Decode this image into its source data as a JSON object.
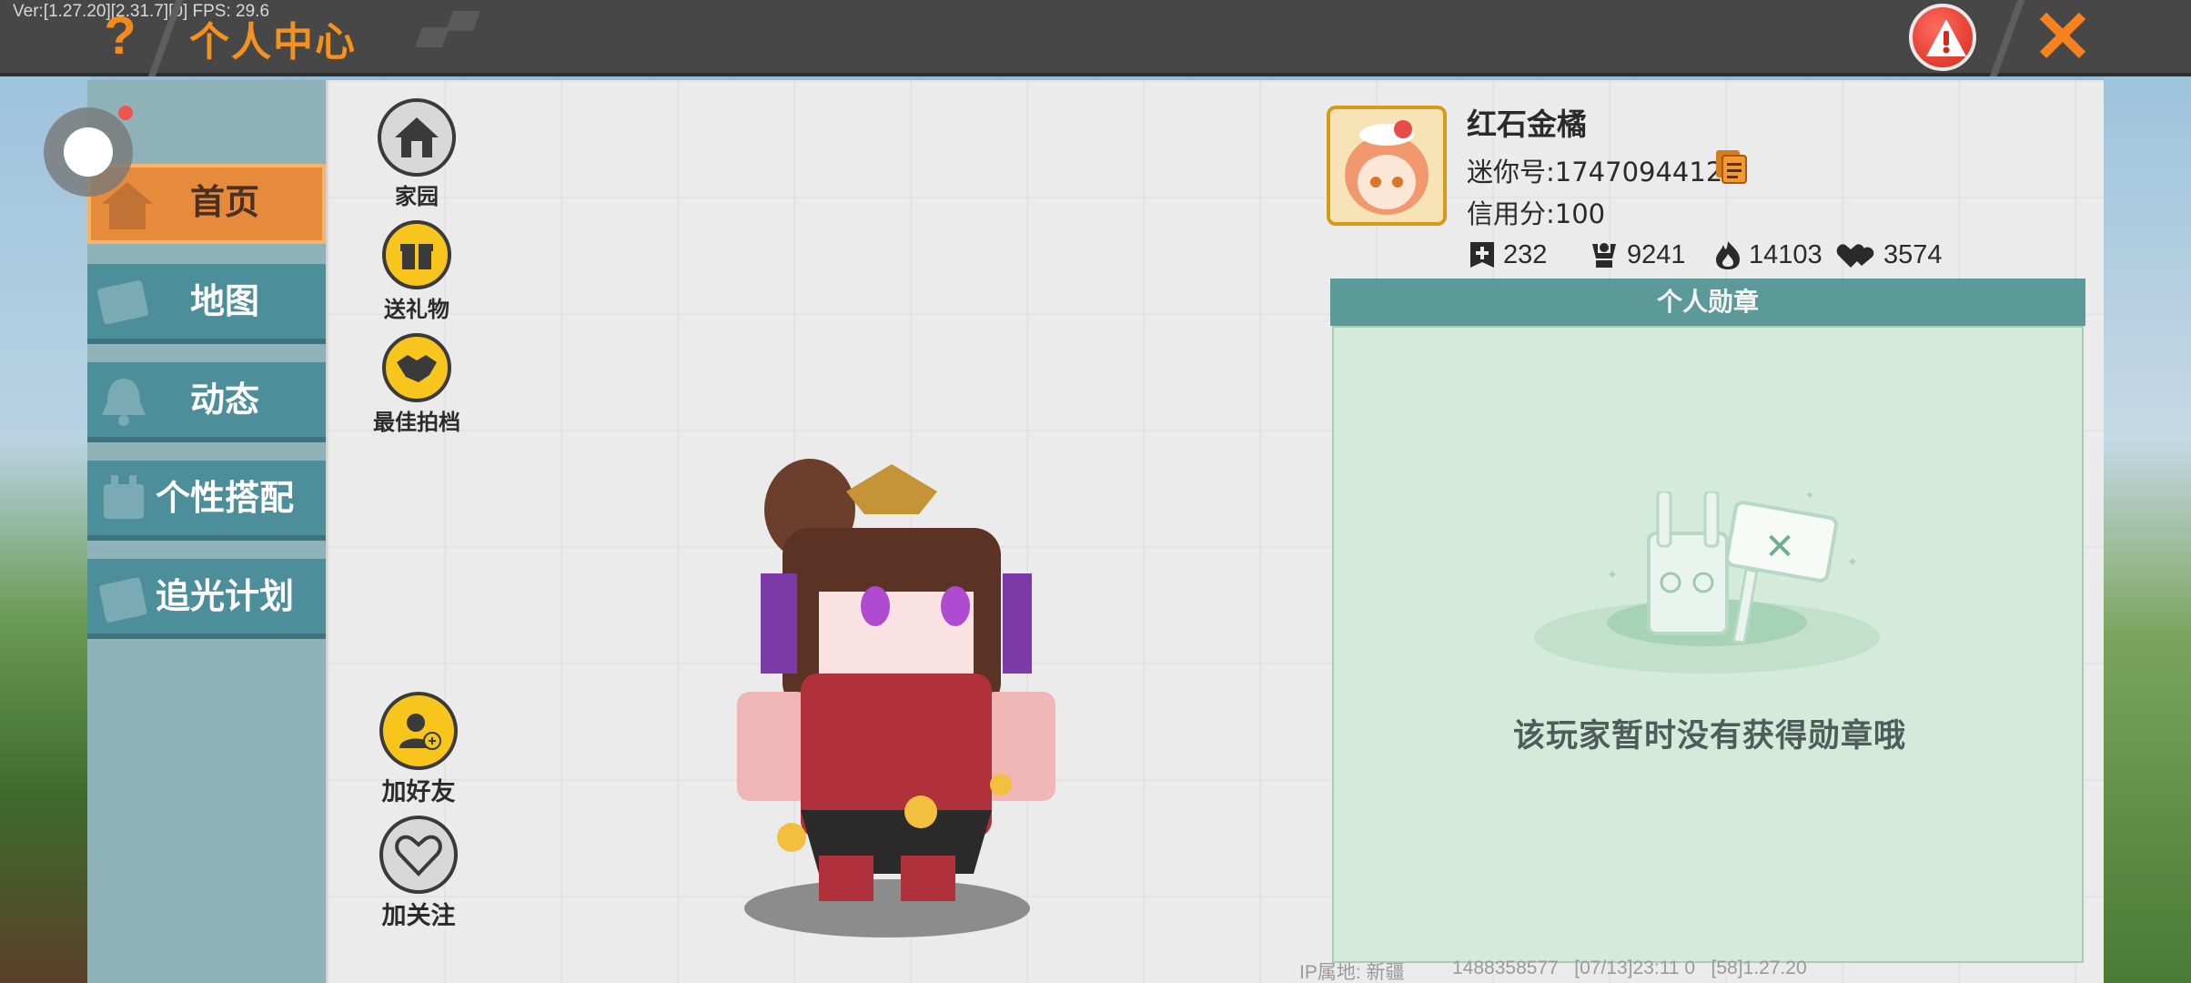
{
  "debug": {
    "version_text": "Ver:[1.27.20][2.31.7][0] FPS: 29.6"
  },
  "header": {
    "title": "个人中心",
    "help_icon": "question-mark-icon",
    "report_icon": "warning-icon",
    "close_icon": "close-icon"
  },
  "sidebar": {
    "items": [
      {
        "label": "首页",
        "icon": "home-icon",
        "active": true
      },
      {
        "label": "地图",
        "icon": "map-icon",
        "active": false
      },
      {
        "label": "动态",
        "icon": "bell-icon",
        "active": false
      },
      {
        "label": "个性搭配",
        "icon": "outfit-icon",
        "active": false
      },
      {
        "label": "追光计划",
        "icon": "calendar-icon",
        "active": false
      }
    ]
  },
  "actions": {
    "homeland": "家园",
    "send_gift": "送礼物",
    "best_partner": "最佳拍档",
    "add_friend": "加好友",
    "follow": "加关注"
  },
  "profile": {
    "nickname": "红石金橘",
    "mini_id": "迷你号:1747094412",
    "credit": "信用分:100",
    "stats": [
      {
        "icon": "add-icon",
        "value": "232"
      },
      {
        "icon": "trophy-icon",
        "value": "9241"
      },
      {
        "icon": "flame-icon",
        "value": "14103"
      },
      {
        "icon": "hearts-icon",
        "value": "3574"
      }
    ]
  },
  "medals": {
    "title": "个人勋章",
    "empty_text": "该玩家暂时没有获得勋章哦"
  },
  "footer": {
    "ip_location": "IP属地: 新疆",
    "server_info": "1488358577   [07/13]23:11 0   [58]1.27.20"
  },
  "colors": {
    "accent_orange": "#f5921e",
    "nav_teal": "#4d8e9b",
    "nav_active": "#e68a3c",
    "medal_header": "#5b9a98",
    "medal_body": "#d4eadb",
    "button_yellow": "#f7c51c"
  }
}
